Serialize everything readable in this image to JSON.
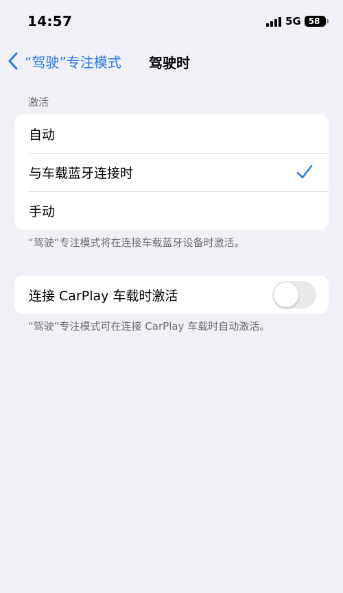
{
  "status_bar": {
    "time": "14:57",
    "network": "5G",
    "battery": "58",
    "battery_fraction": 0.58
  },
  "nav": {
    "back_icon": "chevron-left-icon",
    "back_label": "“驾驶”专注模式",
    "title": "驾驶时"
  },
  "activation": {
    "header": "激活",
    "options": [
      {
        "label": "自动",
        "selected": false
      },
      {
        "label": "与车载蓝牙连接时",
        "selected": true
      },
      {
        "label": "手动",
        "selected": false
      }
    ],
    "footer": "“驾驶”专注模式将在连接车载蓝牙设备时激活。"
  },
  "carplay": {
    "label": "连接 CarPlay 车载时激活",
    "toggle_on": false,
    "footer": "“驾驶”专注模式可在连接 CarPlay 车载时自动激活。"
  },
  "colors": {
    "accent": "#2b7ae6",
    "background": "#f0f0f6",
    "toggle_off": "#e9e9eb"
  }
}
